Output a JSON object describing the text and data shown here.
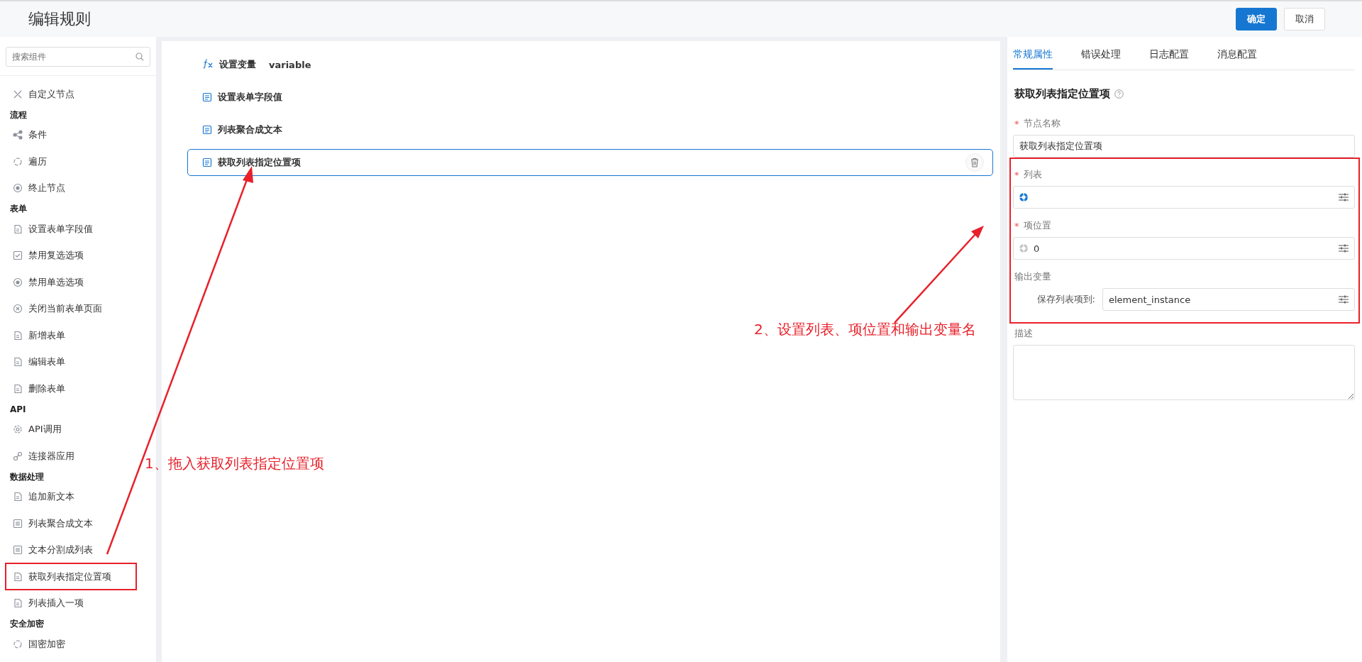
{
  "header": {
    "title": "编辑规则",
    "buttons": [
      {
        "label": "确定",
        "kind": "primary"
      },
      {
        "label": "取消",
        "kind": "default"
      }
    ]
  },
  "sidebar": {
    "search": {
      "placeholder": "搜索组件"
    },
    "items": [
      {
        "kind": "item",
        "label": "自定义节点"
      },
      {
        "kind": "section",
        "label": "流程"
      },
      {
        "kind": "item",
        "label": "条件"
      },
      {
        "kind": "item",
        "label": "遍历"
      },
      {
        "kind": "item",
        "label": "终止节点"
      },
      {
        "kind": "section",
        "label": "表单"
      },
      {
        "kind": "item",
        "label": "设置表单字段值"
      },
      {
        "kind": "item",
        "label": "禁用复选选项"
      },
      {
        "kind": "item",
        "label": "禁用单选选项"
      },
      {
        "kind": "item",
        "label": "关闭当前表单页面"
      },
      {
        "kind": "item",
        "label": "新增表单"
      },
      {
        "kind": "item",
        "label": "编辑表单"
      },
      {
        "kind": "item",
        "label": "删除表单"
      },
      {
        "kind": "section",
        "label": "API"
      },
      {
        "kind": "item",
        "label": "API调用"
      },
      {
        "kind": "item",
        "label": "连接器应用"
      },
      {
        "kind": "section",
        "label": "数据处理"
      },
      {
        "kind": "item",
        "label": "追加新文本"
      },
      {
        "kind": "item",
        "label": "列表聚合成文本"
      },
      {
        "kind": "item",
        "label": "文本分割成列表"
      },
      {
        "kind": "item",
        "label": "获取列表指定位置项"
      },
      {
        "kind": "item",
        "label": "列表插入一项"
      },
      {
        "kind": "section",
        "label": "安全加密"
      },
      {
        "kind": "item",
        "label": "国密加密"
      }
    ]
  },
  "canvas": {
    "nodes": [
      {
        "label": "设置变量",
        "detail": "variable",
        "selected": false
      },
      {
        "label": "设置表单字段值",
        "selected": false
      },
      {
        "label": "列表聚合成文本",
        "selected": false
      },
      {
        "label": "获取列表指定位置项",
        "selected": true
      }
    ]
  },
  "properties": {
    "tabs": [
      {
        "label": "常规属性",
        "selected": true
      },
      {
        "label": "错误处理",
        "selected": false
      },
      {
        "label": "日志配置",
        "selected": false
      },
      {
        "label": "消息配置",
        "selected": false
      }
    ],
    "title": "获取列表指定位置项",
    "fields": [
      {
        "kind": "text",
        "label": "节点名称",
        "required_mark": "*",
        "value": "获取列表指定位置项"
      },
      {
        "kind": "expression",
        "label": "列表",
        "required_mark": "*",
        "active": true
      },
      {
        "kind": "expression",
        "label": "项位置",
        "required_mark": "*",
        "active": false,
        "value": "0"
      },
      {
        "kind": "output",
        "label": "输出变量",
        "sublabel": "保存列表项到:",
        "value": "element_instance"
      },
      {
        "kind": "textarea",
        "label": "描述"
      }
    ]
  },
  "annotations": [
    {
      "text": "1、拖入获取列表指定位置项"
    },
    {
      "text": "2、设置列表、项位置和输出变量名"
    }
  ]
}
